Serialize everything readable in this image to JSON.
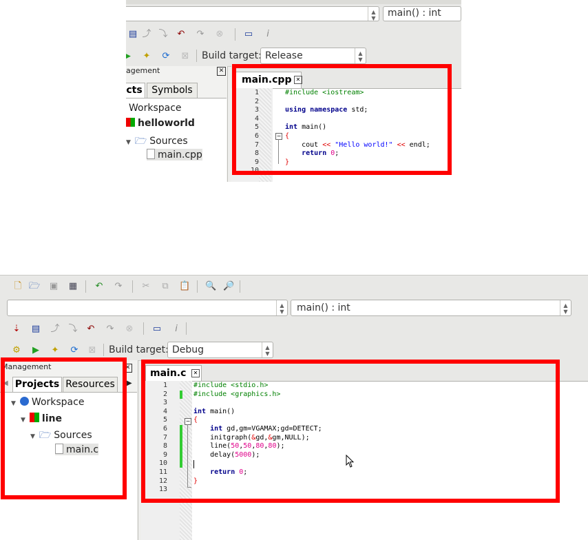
{
  "top": {
    "function_combo": "main() : int",
    "build_target_label": "Build target:",
    "build_target_value": "Release",
    "management_title": "agement",
    "tabs": [
      "cts",
      "Symbols"
    ],
    "tree": {
      "workspace": "Workspace",
      "project": "helloworld",
      "sources": "Sources",
      "file": "main.cpp"
    },
    "editor_tab": "main.cpp",
    "line_numbers": [
      "1",
      "2",
      "3",
      "4",
      "5",
      "6",
      "7",
      "8",
      "9",
      "10"
    ]
  },
  "bottom": {
    "function_combo": "main() : int",
    "build_target_label": "Build target:",
    "build_target_value": "Debug",
    "management_title": "Management",
    "tabs": [
      "Projects",
      "Resources"
    ],
    "tree": {
      "workspace": "Workspace",
      "project": "line",
      "sources": "Sources",
      "file": "main.c"
    },
    "editor_tab": "main.c",
    "line_numbers": [
      "1",
      "2",
      "3",
      "4",
      "5",
      "6",
      "7",
      "8",
      "9",
      "10",
      "11",
      "12",
      "13"
    ]
  },
  "colors": {
    "highlight_box": "#ff0000",
    "change_marker": "#33cc33"
  },
  "icons": [
    "new-file-icon",
    "open-icon",
    "save-icon",
    "save-all-icon",
    "undo-icon",
    "redo-icon",
    "cut-icon",
    "copy-icon",
    "paste-icon",
    "find-icon",
    "replace-icon",
    "build-icon",
    "run-icon",
    "build-run-icon",
    "rebuild-icon",
    "abort-icon",
    "debug-icon",
    "step-icon",
    "close-icon",
    "info-icon",
    "mouse-cursor-icon"
  ]
}
